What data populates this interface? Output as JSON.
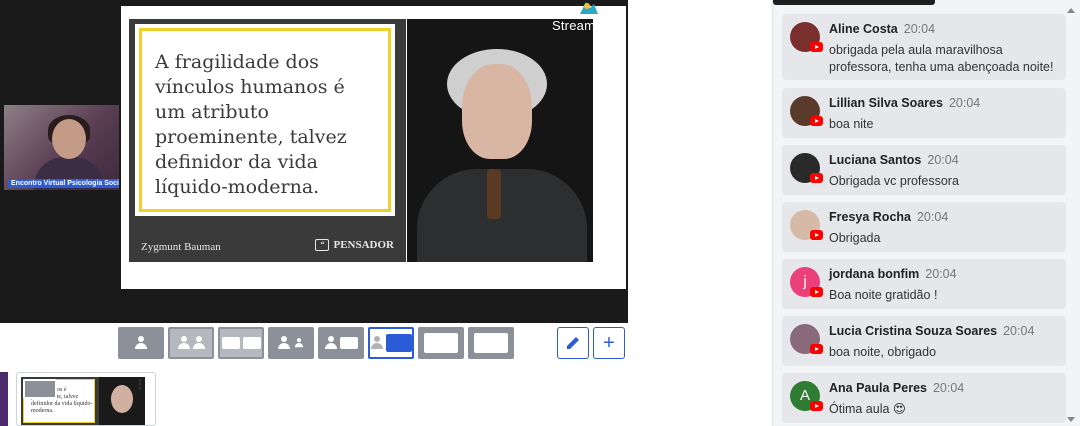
{
  "stage": {
    "camera_label": "Encontro Virtual Psicologia Social",
    "branding": "StreamYard",
    "slide": {
      "quote": "A fragilidade dos vínculos humanos é um atributo proeminente, talvez definidor da vida líquido-moderna.",
      "author": "Zygmunt Bauman",
      "source": "PENSADOR",
      "accent_color": "#f0d12a"
    }
  },
  "layout_bar": {
    "buttons": [
      "solo",
      "group",
      "group-small",
      "leader",
      "thin",
      "picture-in-picture",
      "cinema",
      "screen-only"
    ],
    "selected": "picture-in-picture",
    "edit_icon": "pencil-icon",
    "add_icon": "plus-icon",
    "add_label": "+"
  },
  "thumbnails": {
    "items": [
      {
        "text": "le dos manos é proeminente, talvez definidor da vida líquido-moderna.",
        "more_label": "⋮"
      }
    ]
  },
  "chat": {
    "messages": [
      {
        "author": "Aline Costa",
        "time": "20:04",
        "text": "obrigada pela aula maravilhosa professora, tenha uma abençoada noite!",
        "avatar_color": "#7a2e2e",
        "initial": ""
      },
      {
        "author": "Lillian Silva Soares",
        "time": "20:04",
        "text": "boa nite",
        "avatar_color": "#5a3a2a",
        "initial": ""
      },
      {
        "author": "Luciana Santos",
        "time": "20:04",
        "text": "Obrigada vc professora",
        "avatar_color": "#2a2a2a",
        "initial": ""
      },
      {
        "author": "Fresya Rocha",
        "time": "20:04",
        "text": "Obrigada",
        "avatar_color": "#d7b9a8",
        "initial": ""
      },
      {
        "author": "jordana bonfim",
        "time": "20:04",
        "text": "Boa noite gratidão !",
        "avatar_color": "#ec407a",
        "initial": "j"
      },
      {
        "author": "Lucia Cristina Souza Soares",
        "time": "20:04",
        "text": "boa noite, obrigado",
        "avatar_color": "#8a6a7a",
        "initial": ""
      },
      {
        "author": "Ana Paula Peres",
        "time": "20:04",
        "text": "Ótima aula 😍",
        "avatar_color": "#2e7d32",
        "initial": "A"
      }
    ]
  }
}
